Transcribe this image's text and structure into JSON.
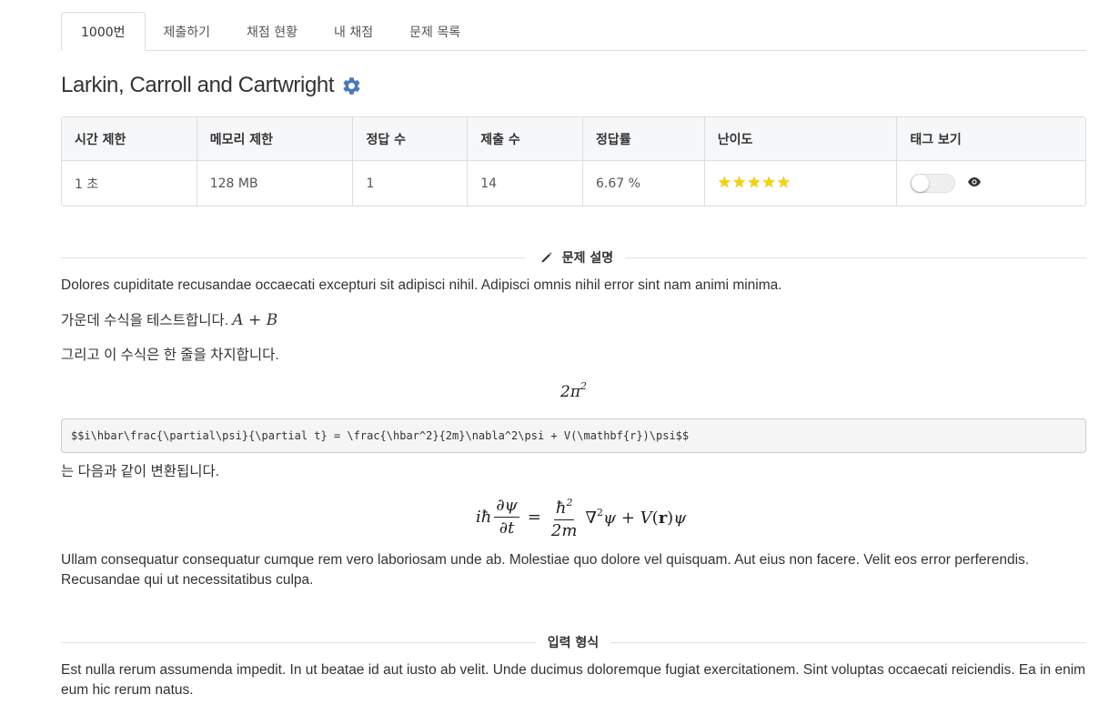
{
  "tabs": [
    {
      "label": "1000번",
      "active": true
    },
    {
      "label": "제출하기",
      "active": false
    },
    {
      "label": "채점 현황",
      "active": false
    },
    {
      "label": "내 채점",
      "active": false
    },
    {
      "label": "문제 목록",
      "active": false
    }
  ],
  "problem": {
    "title": "Larkin, Carroll and Cartwright",
    "settings_icon": "gear-icon"
  },
  "info_table": {
    "headers": [
      "시간 제한",
      "메모리 제한",
      "정답 수",
      "제출 수",
      "정답률",
      "난이도",
      "태그 보기"
    ],
    "values": {
      "time_limit": "1 초",
      "memory_limit": "128 MB",
      "accepted": "1",
      "submissions": "14",
      "accept_rate": "6.67 %",
      "difficulty_stars": 5,
      "tags_toggle": false
    }
  },
  "sections": {
    "description": {
      "heading": "문제 설명",
      "icon": "pencil-icon",
      "p1": "Dolores cupiditate recusandae occaecati excepturi sit adipisci nihil. Adipisci omnis nihil error sint nam animi minima.",
      "p2_text": "가운데 수식을 테스트합니다.",
      "p2_math": "A + B",
      "p3": "그리고 이 수식은 한 줄을 차지합니다.",
      "display_math_base": "2π",
      "display_math_exp": "2",
      "code": "$$i\\hbar\\frac{\\partial\\psi}{\\partial t} = \\frac{\\hbar^2}{2m}\\nabla^2\\psi + V(\\mathbf{r})\\psi$$",
      "p4": "는 다음과 같이 변환됩니다.",
      "p5": "Ullam consequatur consequatur cumque rem vero laboriosam unde ab. Molestiae quo dolore vel quisquam. Aut eius non facere. Velit eos error perferendis. Recusandae qui ut necessitatibus culpa."
    },
    "input": {
      "heading": "입력 형식",
      "p1": "Est nulla rerum assumenda impedit. In ut beatae id aut iusto ab velit. Unde ducimus doloremque fugiat exercitationem. Sint voluptas occaecati reiciendis. Ea in enim eum hic rerum natus."
    }
  },
  "colors": {
    "accent_gear": "#4a7ab8",
    "star": "#f5d300",
    "border": "#dddddd",
    "header_bg": "#f6f7f9"
  }
}
